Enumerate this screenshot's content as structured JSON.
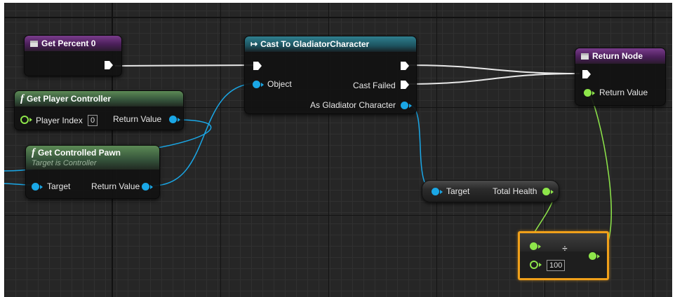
{
  "nodes": {
    "get_percent": {
      "title": "Get Percent 0"
    },
    "get_player_controller": {
      "title": "Get Player Controller",
      "fx": "f",
      "pins": {
        "player_index_label": "Player Index",
        "player_index_value": "0",
        "return_value": "Return Value"
      }
    },
    "get_controlled_pawn": {
      "title": "Get Controlled Pawn",
      "subtitle": "Target is Controller",
      "fx": "f",
      "pins": {
        "target": "Target",
        "return_value": "Return Value"
      }
    },
    "cast": {
      "title": "Cast To GladiatorCharacter",
      "title_icon": "↦",
      "pins": {
        "object": "Object",
        "cast_failed": "Cast Failed",
        "as_gladiator": "As Gladiator Character"
      }
    },
    "return_node": {
      "title": "Return Node",
      "pins": {
        "return_value": "Return Value"
      }
    },
    "total_health": {
      "pins": {
        "target": "Target",
        "total_health": "Total Health"
      }
    },
    "divide": {
      "operator": "÷",
      "input_value": "100"
    }
  },
  "colors": {
    "purple_header": "#4b1f5a",
    "green_header": "#34523a",
    "teal_header": "#1d5460",
    "object_pin": "#1aa7e6",
    "float_pin": "#8ee64a",
    "selected_outline": "#f0a01a"
  }
}
